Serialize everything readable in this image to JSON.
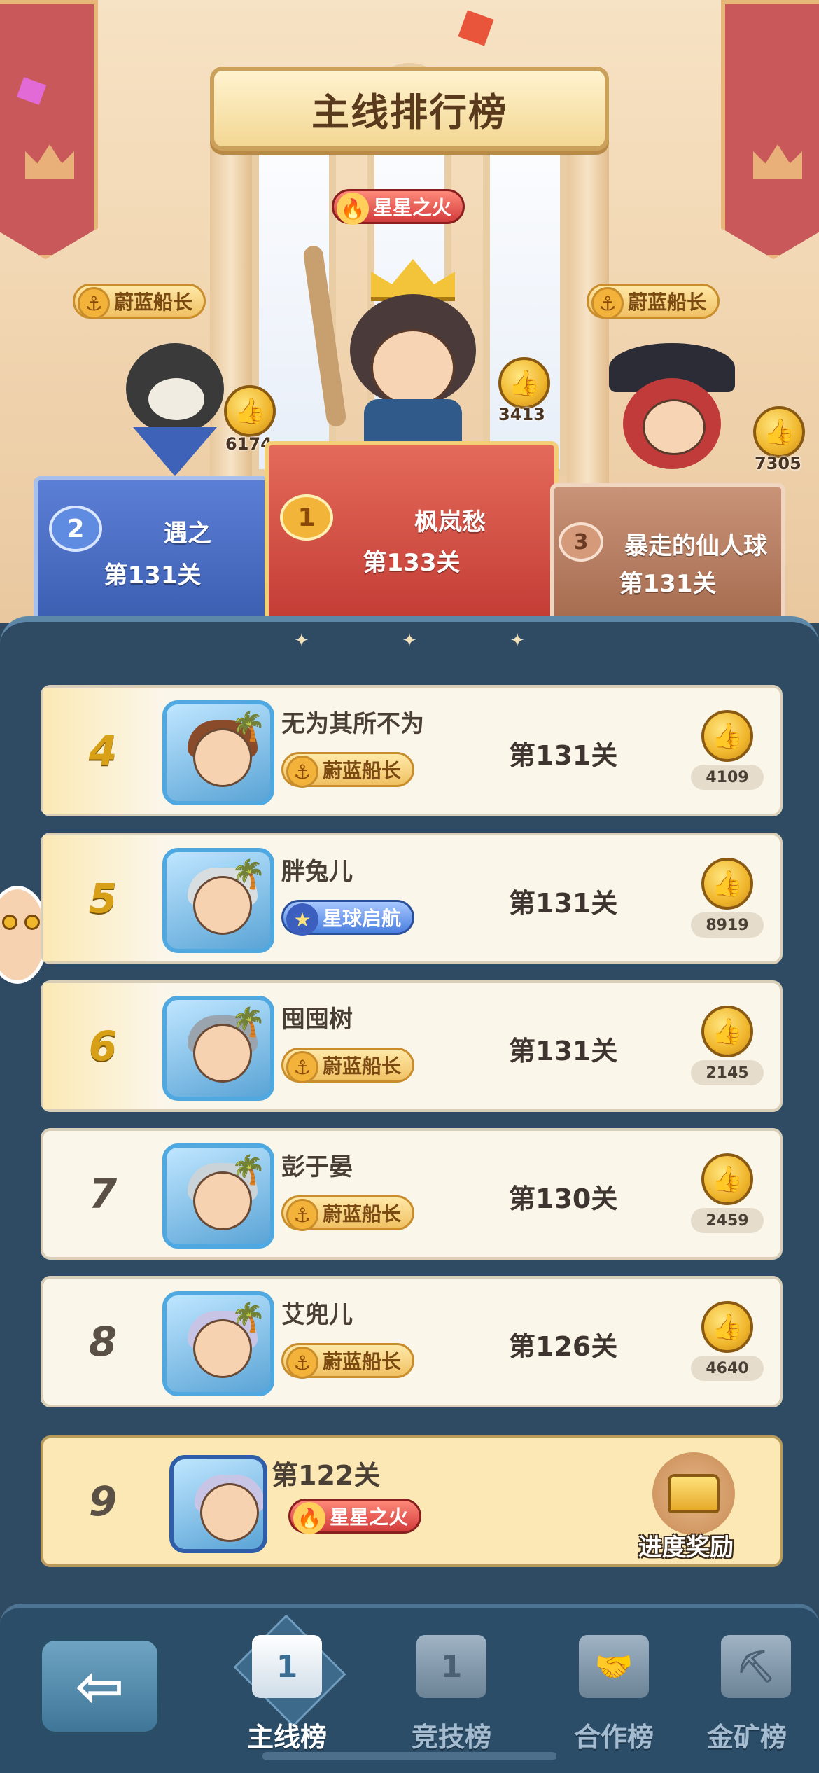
{
  "title": "主线排行榜",
  "podium": [
    {
      "rank": "1",
      "name": "枫岚愁",
      "level": "第133关",
      "tag": "星星之火",
      "tag_type": "fire",
      "likes": "3413",
      "color": "#d9534a"
    },
    {
      "rank": "2",
      "name": "遇之",
      "level": "第131关",
      "tag": "蔚蓝船长",
      "tag_type": "anchor",
      "likes": "6174",
      "color": "#4a6fc4"
    },
    {
      "rank": "3",
      "name": "暴走的仙人球",
      "level": "第131关",
      "tag": "蔚蓝船长",
      "tag_type": "anchor",
      "likes": "7305",
      "color": "#b77f5e"
    }
  ],
  "rows": [
    {
      "rank": "4",
      "name": "无为其所不为",
      "tag": "蔚蓝船长",
      "tag_type": "anchor",
      "level": "第131关",
      "likes": "4109",
      "hair": "#8a4b2a"
    },
    {
      "rank": "5",
      "name": "胖兔儿",
      "tag": "星球启航",
      "tag_type": "star",
      "level": "第131关",
      "likes": "8919",
      "hair": "#d8dde0"
    },
    {
      "rank": "6",
      "name": "囤囤树",
      "tag": "蔚蓝船长",
      "tag_type": "anchor",
      "level": "第131关",
      "likes": "2145",
      "hair": "#9aa4ae"
    },
    {
      "rank": "7",
      "name": "彭于晏",
      "tag": "蔚蓝船长",
      "tag_type": "anchor",
      "level": "第130关",
      "likes": "2459",
      "hair": "#c9d3d8"
    },
    {
      "rank": "8",
      "name": "艾兜儿",
      "tag": "蔚蓝船长",
      "tag_type": "anchor",
      "level": "第126关",
      "likes": "4640",
      "hair": "#c8c4e6"
    }
  ],
  "me": {
    "rank": "9",
    "level": "第122关",
    "tag": "星星之火",
    "reward_label": "进度奖励"
  },
  "nav": {
    "back": "⇦",
    "tabs": [
      {
        "label": "主线榜",
        "icon": "1"
      },
      {
        "label": "竞技榜",
        "icon": "1"
      },
      {
        "label": "合作榜",
        "icon": "🤝"
      },
      {
        "label": "金矿榜",
        "icon": "⛏"
      }
    ]
  },
  "icons": {
    "like": "👍",
    "anchor": "⚓",
    "fire": "🔥",
    "star": "★",
    "palm": "🌴"
  },
  "colors": {
    "accent_gold": "#d8a016",
    "panel": "#2f4a63",
    "row_bg": "#fbf6ea"
  }
}
